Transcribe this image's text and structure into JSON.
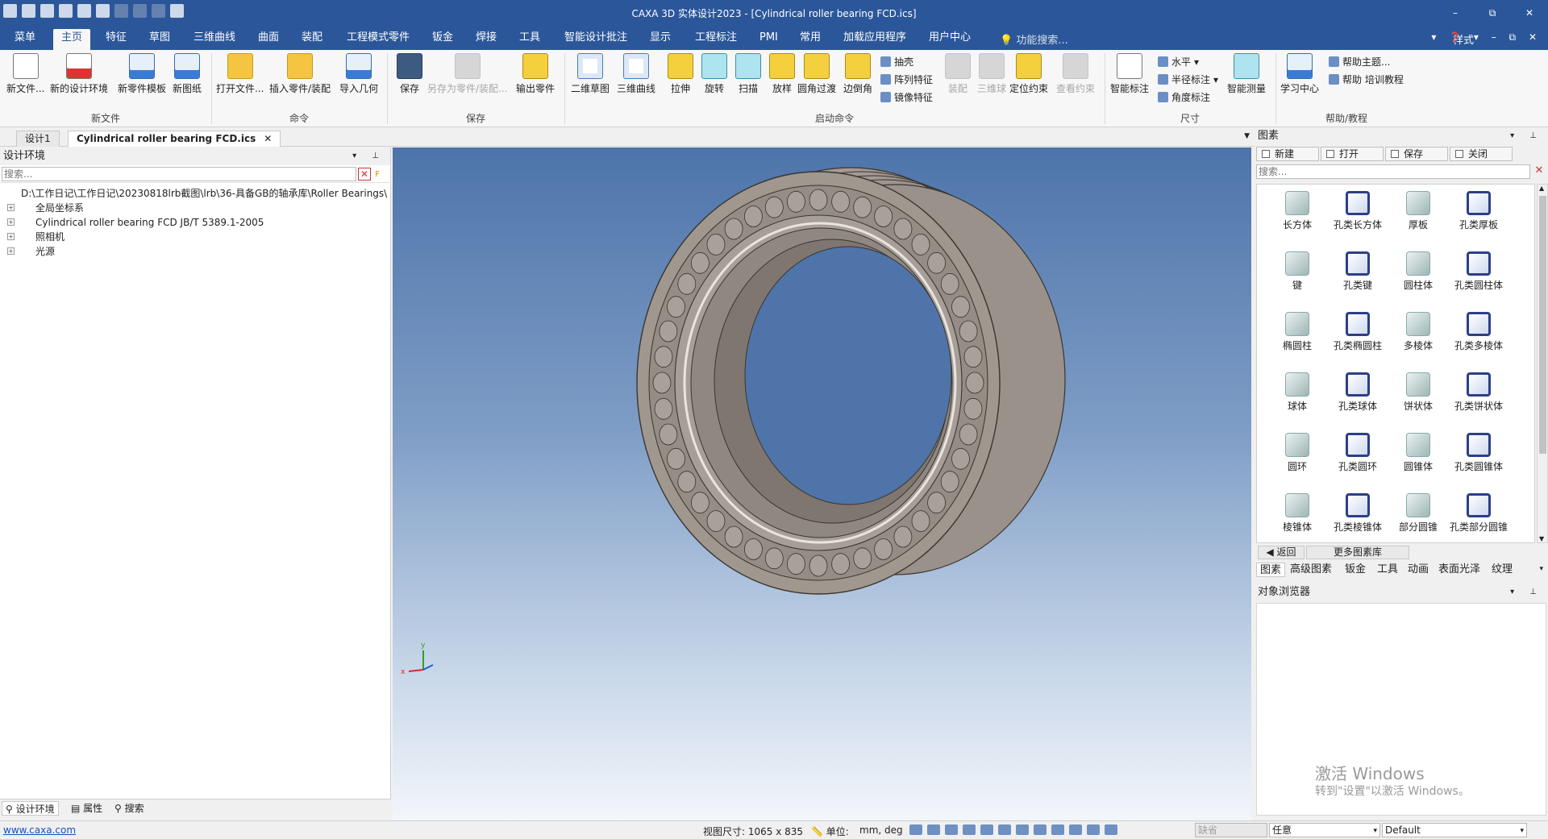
{
  "window": {
    "title": "CAXA 3D 实体设计2023 - [Cylindrical roller bearing FCD.ics]",
    "minimize": "–",
    "restore": "⧉",
    "close": "✕"
  },
  "menu": {
    "tabs": [
      "菜单",
      "主页",
      "特征",
      "草图",
      "三维曲线",
      "曲面",
      "装配",
      "工程模式零件",
      "钣金",
      "焊接",
      "工具",
      "智能设计批注",
      "显示",
      "工程标注",
      "PMI",
      "常用",
      "加载应用程序",
      "用户中心"
    ],
    "active_index": 1,
    "search_placeholder": "功能搜索...",
    "style_label": "样式",
    "right_icons": "▾ ❓ ▾ – ⧉ ✕"
  },
  "ribbon": {
    "new_file": {
      "label": "新文件",
      "buttons": [
        "新文件...",
        "新的设计环境",
        "新零件模板",
        "新图纸"
      ]
    },
    "command": {
      "label": "命令",
      "buttons": [
        "打开文件...",
        "插入零件/装配",
        "导入几何"
      ]
    },
    "save": {
      "label": "保存",
      "buttons": [
        "保存",
        "另存为零件/装配...",
        "输出零件"
      ]
    },
    "launch": {
      "label": "启动命令",
      "buttons": [
        "二维草图",
        "三维曲线",
        "拉伸",
        "旋转",
        "扫描",
        "放样",
        "圆角过渡",
        "边倒角"
      ],
      "small": [
        "抽壳",
        "阵列特征",
        "镜像特征"
      ],
      "more": [
        "装配",
        "三维球",
        "定位约束",
        "查看约束"
      ]
    },
    "dimension": {
      "label": "尺寸",
      "buttons": [
        "智能标注",
        "智能测量"
      ],
      "small": [
        "水平",
        "半径标注",
        "角度标注"
      ]
    },
    "help": {
      "label": "帮助/教程",
      "buttons": [
        "学习中心"
      ],
      "small": [
        "帮助主题...",
        "帮助 培训教程"
      ]
    }
  },
  "doc_tabs": [
    "设计1",
    "Cylindrical roller bearing FCD.ics"
  ],
  "left_panel": {
    "title": "设计环境",
    "search_placeholder": "搜索...",
    "tree": [
      {
        "label": "D:\\工作日记\\工作日记\\20230818lrb截图\\lrb\\36-具备GB的轴承库\\Roller Bearings\\",
        "color": "#cc2222"
      },
      {
        "label": "全局坐标系",
        "color": "#333333"
      },
      {
        "label": "Cylindrical roller bearing FCD JB/T 5389.1-2005",
        "color": "#2255aa"
      },
      {
        "label": "照相机",
        "color": "#444444"
      },
      {
        "label": "光源",
        "color": "#d4a017"
      }
    ],
    "bottom_tabs": [
      "设计环境",
      "属性",
      "搜索"
    ]
  },
  "viewport": {
    "axis_x": "x",
    "axis_y": "y",
    "bearing_color": "#9e958e"
  },
  "right_panel": {
    "title": "图素",
    "tools": [
      "新建",
      "打开",
      "保存",
      "关闭"
    ],
    "search_placeholder": "搜索...",
    "items": [
      {
        "label": "长方体",
        "kind": "solid"
      },
      {
        "label": "孔类长方体",
        "kind": "hole"
      },
      {
        "label": "厚板",
        "kind": "solid"
      },
      {
        "label": "孔类厚板",
        "kind": "hole"
      },
      {
        "label": "键",
        "kind": "solid"
      },
      {
        "label": "孔类键",
        "kind": "hole"
      },
      {
        "label": "圆柱体",
        "kind": "solid"
      },
      {
        "label": "孔类圆柱体",
        "kind": "hole"
      },
      {
        "label": "椭圆柱",
        "kind": "solid"
      },
      {
        "label": "孔类椭圆柱",
        "kind": "hole"
      },
      {
        "label": "多棱体",
        "kind": "solid"
      },
      {
        "label": "孔类多棱体",
        "kind": "hole"
      },
      {
        "label": "球体",
        "kind": "solid"
      },
      {
        "label": "孔类球体",
        "kind": "hole"
      },
      {
        "label": "饼状体",
        "kind": "solid"
      },
      {
        "label": "孔类饼状体",
        "kind": "hole"
      },
      {
        "label": "圆环",
        "kind": "solid"
      },
      {
        "label": "孔类圆环",
        "kind": "hole"
      },
      {
        "label": "圆锥体",
        "kind": "solid"
      },
      {
        "label": "孔类圆锥体",
        "kind": "hole"
      },
      {
        "label": "棱锥体",
        "kind": "solid"
      },
      {
        "label": "孔类棱锥体",
        "kind": "hole"
      },
      {
        "label": "部分圆锥",
        "kind": "solid"
      },
      {
        "label": "孔类部分圆锥",
        "kind": "hole"
      }
    ],
    "nav": [
      "返回",
      "更多图素库"
    ],
    "tabs": [
      "图素",
      "高级图素",
      "钣金",
      "工具",
      "动画",
      "表面光泽",
      "纹理"
    ],
    "object_browser": "对象浏览器"
  },
  "watermark": {
    "line1": "激活 Windows",
    "line2": "转到\"设置\"以激活 Windows。"
  },
  "status": {
    "link": "www.caxa.com",
    "view_size": "视图尺寸: 1065 x  835",
    "unit_label": "单位:",
    "unit_value": "mm, deg",
    "combo_disabled": "缺省",
    "combo_filter": "任意",
    "combo_style": "Default"
  }
}
